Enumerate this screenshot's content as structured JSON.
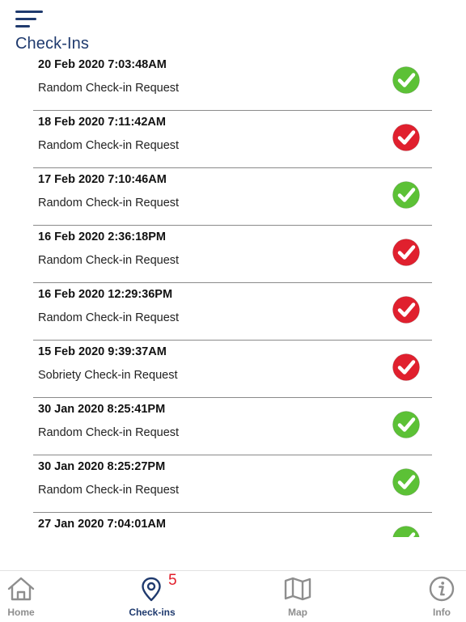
{
  "header": {
    "title": "Check-Ins"
  },
  "checkins": [
    {
      "datetime": "20 Feb 2020 7:03:48AM",
      "type": "Random Check-in Request",
      "status": "success"
    },
    {
      "datetime": "18 Feb 2020 7:11:42AM",
      "type": "Random Check-in Request",
      "status": "failed"
    },
    {
      "datetime": "17 Feb 2020 7:10:46AM",
      "type": "Random Check-in Request",
      "status": "success"
    },
    {
      "datetime": "16 Feb 2020 2:36:18PM",
      "type": "Random Check-in Request",
      "status": "failed"
    },
    {
      "datetime": "16 Feb 2020 12:29:36PM",
      "type": "Random Check-in Request",
      "status": "failed"
    },
    {
      "datetime": "15 Feb 2020 9:39:37AM",
      "type": "Sobriety Check-in Request",
      "status": "failed"
    },
    {
      "datetime": "30 Jan 2020 8:25:41PM",
      "type": "Random Check-in Request",
      "status": "success"
    },
    {
      "datetime": "30 Jan 2020 8:25:27PM",
      "type": "Random Check-in Request",
      "status": "success"
    },
    {
      "datetime": "27 Jan 2020 7:04:01AM",
      "type": "",
      "status": "success"
    }
  ],
  "colors": {
    "success": "#5cc136",
    "failed": "#e0202e",
    "brand": "#1f3a6e"
  },
  "tabs": [
    {
      "label": "Home",
      "icon": "home-icon"
    },
    {
      "label": "Check-ins",
      "icon": "map-pin-icon",
      "badge": "5",
      "active": true
    },
    {
      "label": "Map",
      "icon": "map-icon"
    },
    {
      "label": "Info",
      "icon": "info-icon"
    }
  ]
}
